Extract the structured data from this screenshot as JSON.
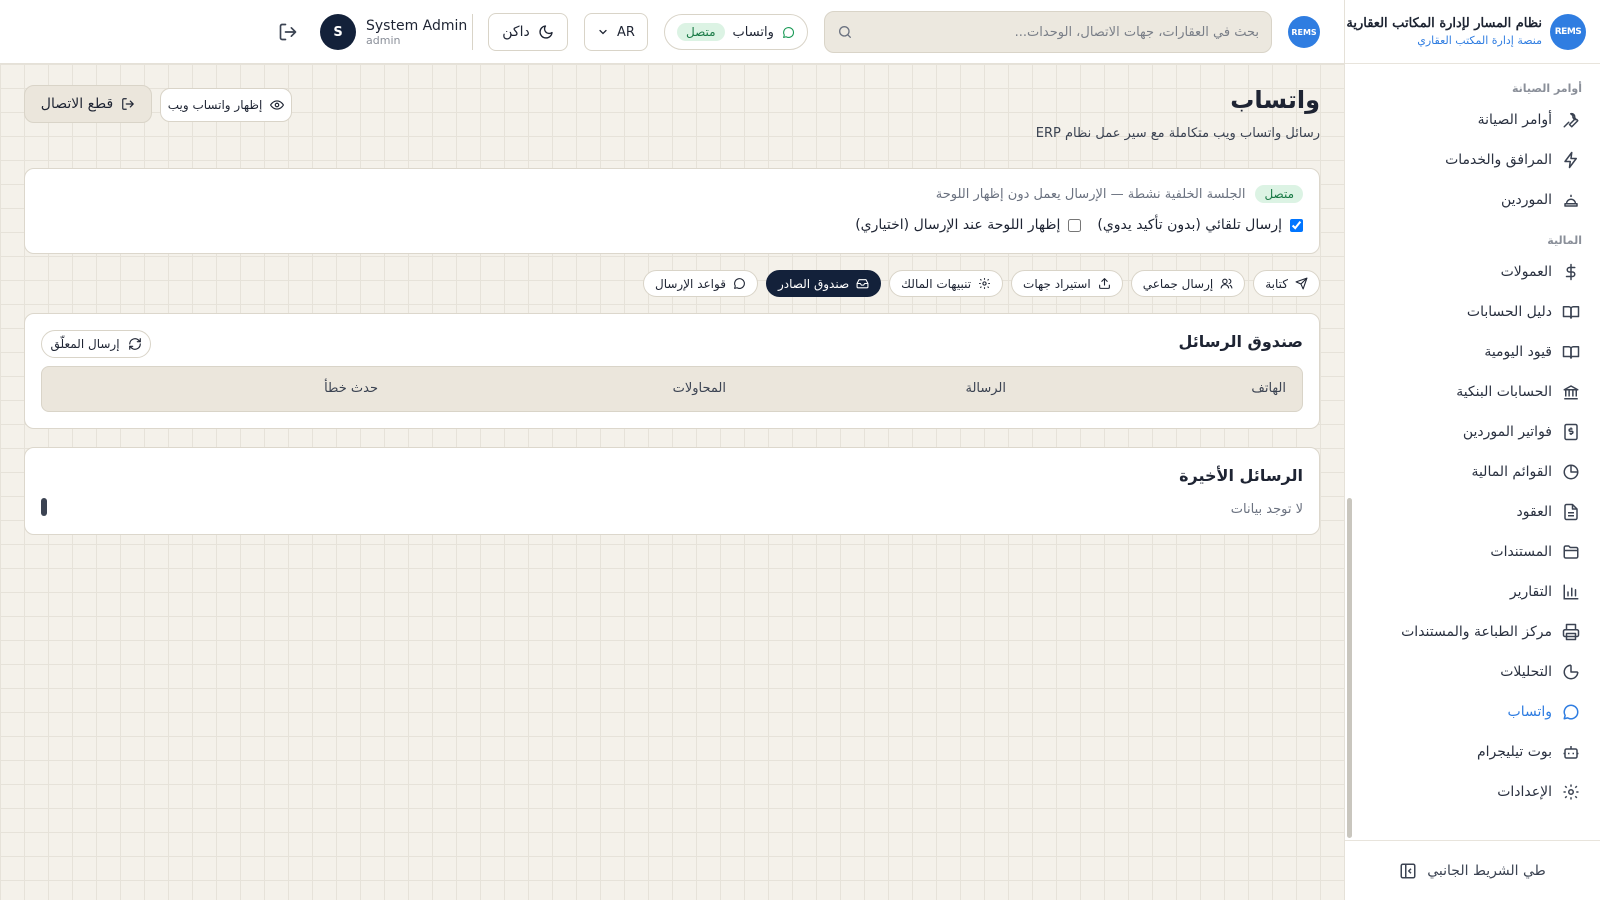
{
  "sidebar": {
    "logo_text": "REMS",
    "brand_title": "نظام المسار لإدارة المكاتب العقارية",
    "brand_subtitle": "منصة إدارة المكتب العقاري",
    "sections": {
      "maintenance": "أوامر الصيانة",
      "finance": "المالية"
    },
    "items": [
      {
        "label": "أوامر الصيانة",
        "icon": "wrench-icon"
      },
      {
        "label": "المرافق والخدمات",
        "icon": "bolt-icon"
      },
      {
        "label": "الموردين",
        "icon": "tools-icon"
      },
      {
        "label": "العمولات",
        "icon": "dollar-icon"
      },
      {
        "label": "دليل الحسابات",
        "icon": "book-icon"
      },
      {
        "label": "قيود اليومية",
        "icon": "book-open-icon"
      },
      {
        "label": "الحسابات البنكية",
        "icon": "bank-icon"
      },
      {
        "label": "فواتير الموردين",
        "icon": "invoice-icon"
      },
      {
        "label": "القوائم المالية",
        "icon": "pie-chart-icon"
      },
      {
        "label": "العقود",
        "icon": "file-text-icon"
      },
      {
        "label": "المستندات",
        "icon": "folder-icon"
      },
      {
        "label": "التقارير",
        "icon": "bar-chart-icon"
      },
      {
        "label": "مركز الطباعة والمستندات",
        "icon": "printer-icon"
      },
      {
        "label": "التحليلات",
        "icon": "analytics-icon"
      },
      {
        "label": "واتساب",
        "icon": "chat-icon",
        "active": true
      },
      {
        "label": "بوت تيليجرام",
        "icon": "bot-icon"
      },
      {
        "label": "الإعدادات",
        "icon": "gear-icon"
      }
    ],
    "collapse_label": "طي الشريط الجانبي"
  },
  "topbar": {
    "logo_text": "REMS",
    "search_placeholder": "بحث في العقارات، جهات الاتصال، الوحدات...",
    "whatsapp_label": "واتساب",
    "whatsapp_status": "متصل",
    "language": "AR",
    "theme_label": "داكن",
    "user_initial": "S",
    "user_name": "System Admin",
    "user_role": "admin"
  },
  "page": {
    "title": "واتساب",
    "subtitle": "رسائل واتساب ويب متكاملة مع سير عمل نظام ERP",
    "disconnect_label": "قطع الاتصال",
    "show_web_label": "إظهار واتساب ويب"
  },
  "status": {
    "badge": "متصل",
    "message": "الجلسة الخلفية نشطة — الإرسال يعمل دون إظهار اللوحة",
    "auto_send_label": "إرسال تلقائي (بدون تأكيد يدوي)",
    "auto_send_checked": true,
    "show_panel_label": "إظهار اللوحة عند الإرسال (اختياري)",
    "show_panel_checked": false
  },
  "tabs": [
    {
      "label": "كتابة",
      "icon": "send-icon"
    },
    {
      "label": "إرسال جماعي",
      "icon": "users-icon"
    },
    {
      "label": "استيراد جهات",
      "icon": "upload-icon"
    },
    {
      "label": "تنبيهات المالك",
      "icon": "gear-icon"
    },
    {
      "label": "صندوق الصادر",
      "icon": "inbox-icon",
      "active": true
    },
    {
      "label": "قواعد الإرسال",
      "icon": "chat-icon"
    }
  ],
  "outbox": {
    "title": "صندوق الرسائل",
    "resend_label": "إرسال المعلّق",
    "columns": [
      "الهاتف",
      "الرسالة",
      "المحاولات",
      "حدث خطأ"
    ]
  },
  "recent": {
    "title": "الرسائل الأخيرة",
    "empty_text": "لا توجد بيانات"
  },
  "colors": {
    "accent": "#2f7de1",
    "dark": "#13213a",
    "success": "#1a9a56",
    "background": "#f4f1ea"
  }
}
